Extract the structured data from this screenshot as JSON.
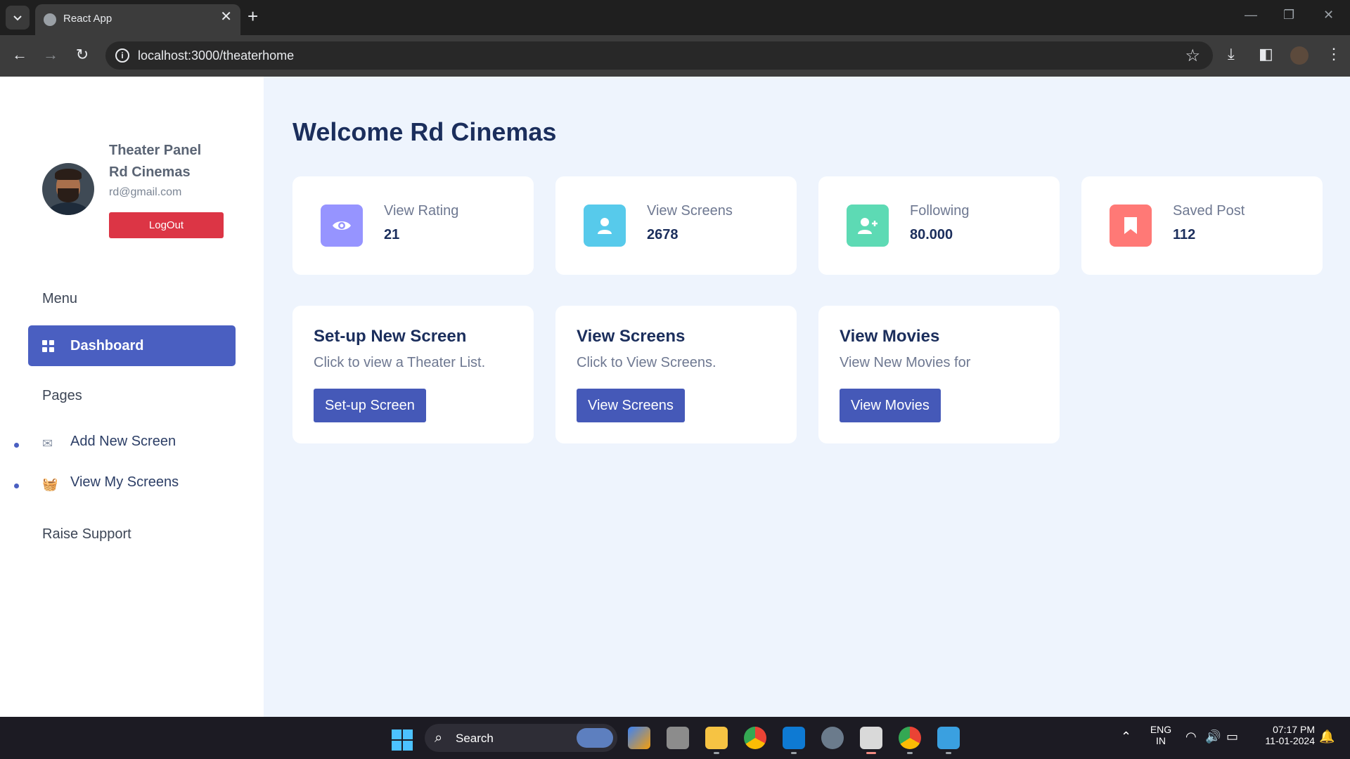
{
  "browser": {
    "tab_title": "React App",
    "url": "localhost:3000/theaterhome",
    "new_tab_symbol": "+",
    "close_symbol": "✕"
  },
  "sidebar": {
    "panel_title": "Theater Panel",
    "theater_name": "Rd Cinemas",
    "email": "rd@gmail.com",
    "logout_label": "LogOut",
    "menu_heading": "Menu",
    "dashboard_label": "Dashboard",
    "pages_heading": "Pages",
    "pages": [
      {
        "label": "Add New Screen",
        "icon": "envelope-icon"
      },
      {
        "label": "View My Screens",
        "icon": "basket-icon"
      }
    ],
    "support_label": "Raise Support"
  },
  "main": {
    "welcome": "Welcome Rd Cinemas",
    "stats": [
      {
        "label": "View Rating",
        "value": "21",
        "icon": "eye-icon",
        "color": "#9694ff"
      },
      {
        "label": "View Screens",
        "value": "2678",
        "icon": "user-icon",
        "color": "#57caeb"
      },
      {
        "label": "Following",
        "value": "80.000",
        "icon": "user-plus-icon",
        "color": "#5ddab4"
      },
      {
        "label": "Saved Post",
        "value": "112",
        "icon": "bookmark-icon",
        "color": "#ff7976"
      }
    ],
    "actions": [
      {
        "title": "Set-up New Screen",
        "description": "Click to view a Theater List.",
        "button": "Set-up Screen"
      },
      {
        "title": "View Screens",
        "description": "Click to View Screens.",
        "button": "View Screens"
      },
      {
        "title": "View Movies",
        "description": "View New Movies for",
        "button": "View Movies"
      }
    ]
  },
  "taskbar": {
    "search_label": "Search",
    "language": "ENG",
    "region": "IN",
    "time": "07:17 PM",
    "date": "11-01-2024"
  }
}
